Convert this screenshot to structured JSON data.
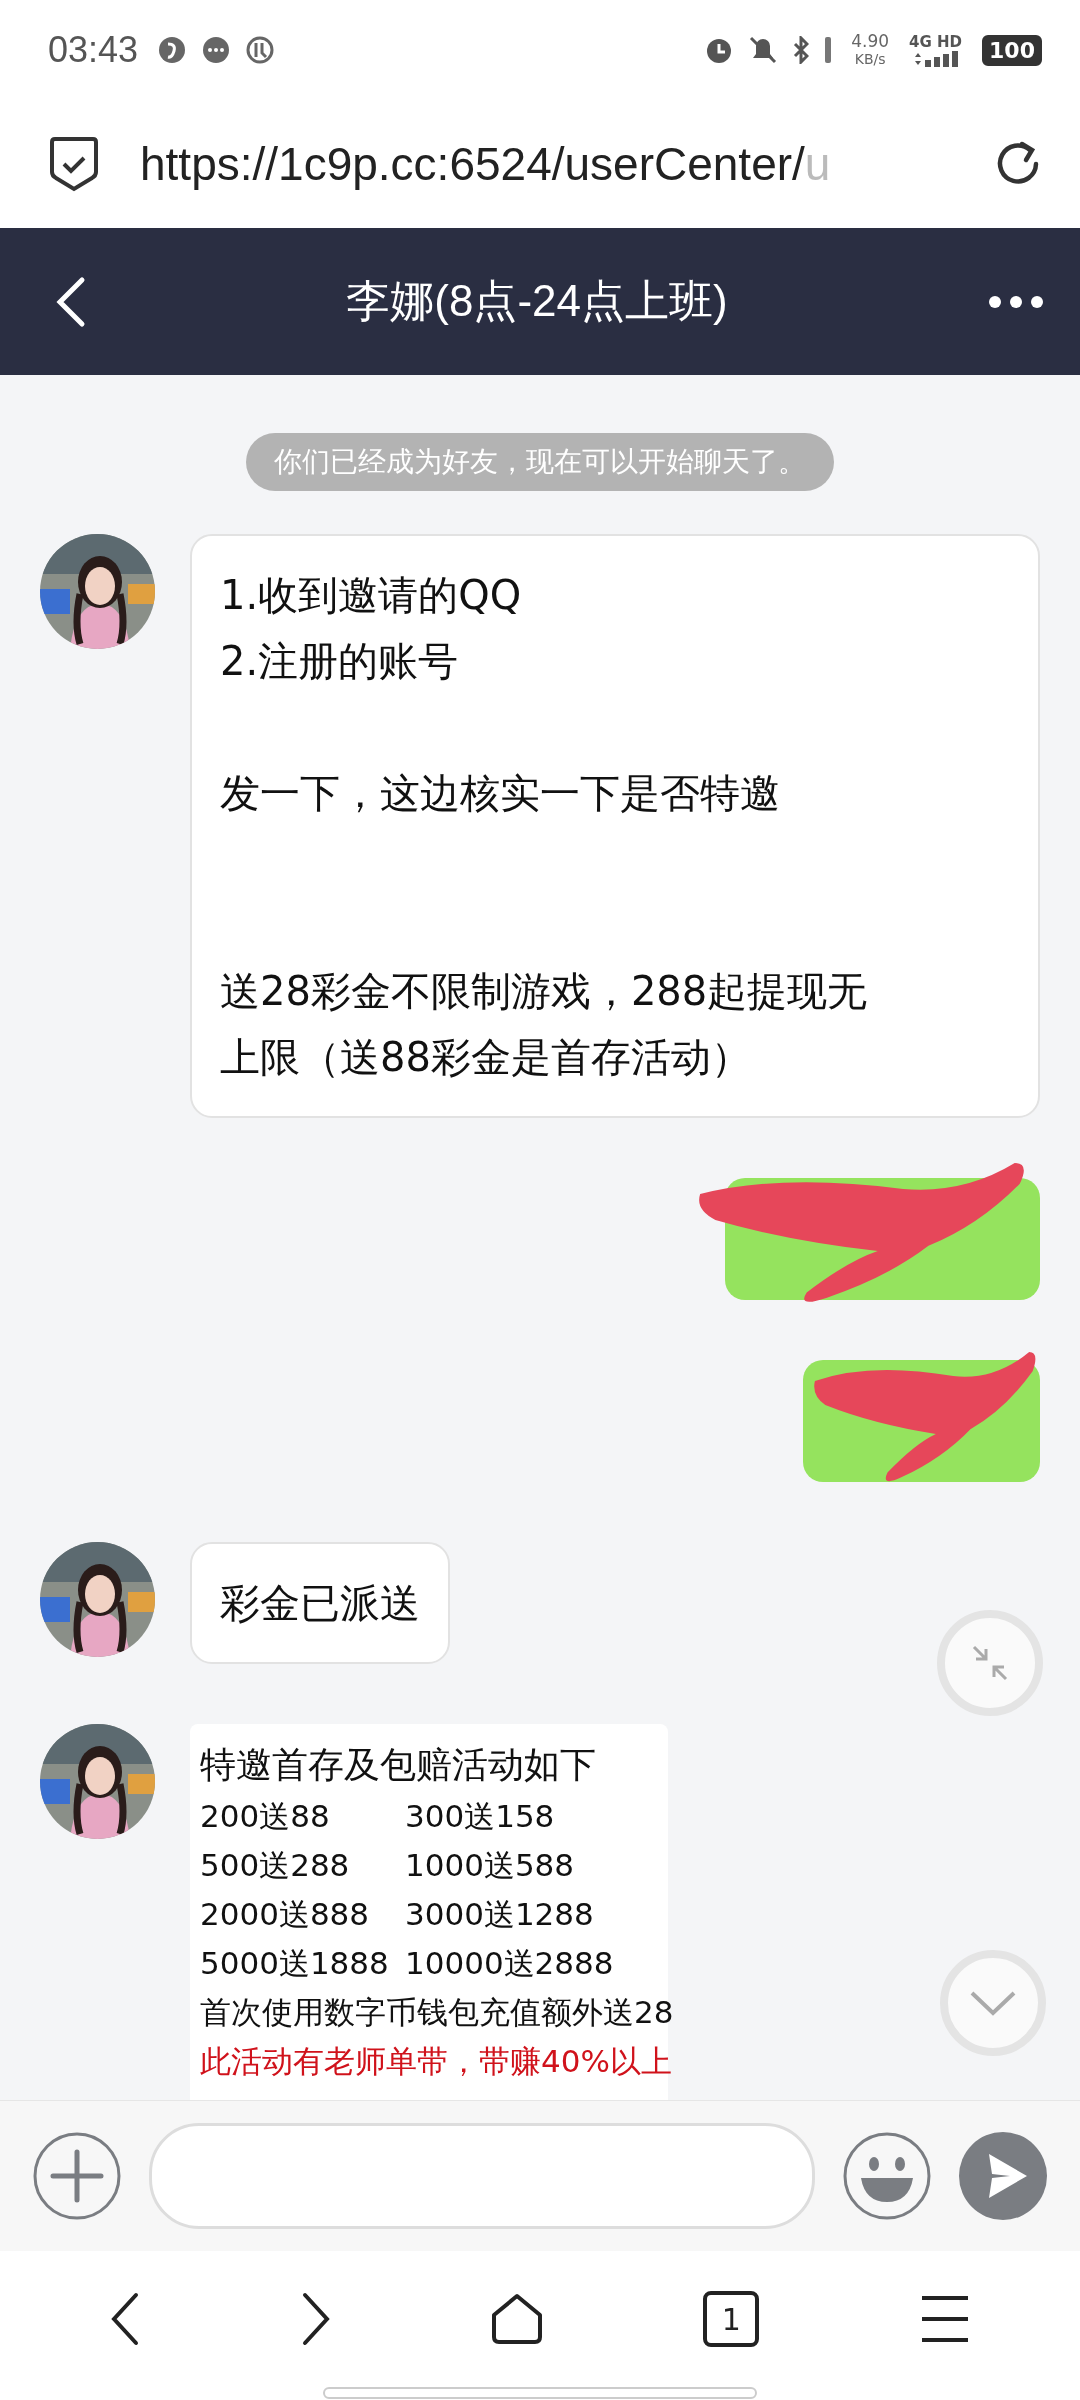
{
  "status_bar": {
    "time": "03:43",
    "speed": "4.90",
    "speed_unit": "KB/s",
    "network": "4G",
    "hd": "HD",
    "battery": "100"
  },
  "browser": {
    "url": "https://1c9p.cc:6524/userCenter/",
    "url_faded": "u"
  },
  "header": {
    "title": "李娜(8点-24点上班)"
  },
  "notice": "你们已经成为好友，现在可以开始聊天了。",
  "messages": [
    {
      "outgoing": false,
      "kind": "text",
      "paragraphs": [
        [
          "1.收到邀请的QQ",
          "2.注册的账号"
        ],
        [
          "发一下，这边核实一下是否特邀"
        ],
        [
          "送28彩金不限制游戏，288起提现无上限（送88彩金是首存活动）"
        ]
      ]
    },
    {
      "outgoing": true,
      "kind": "redacted"
    },
    {
      "outgoing": true,
      "kind": "redacted"
    },
    {
      "outgoing": false,
      "kind": "text",
      "paragraphs": [
        [
          "彩金已派送"
        ]
      ]
    },
    {
      "outgoing": false,
      "kind": "promo",
      "title": "特邀首存及包赔活动如下",
      "rows": [
        [
          "200送88",
          "300送158"
        ],
        [
          "500送288",
          "1000送588"
        ],
        [
          "2000送888",
          "3000送1288"
        ],
        [
          "5000送1888",
          "10000送2888"
        ]
      ],
      "note": "首次使用数字币钱包充值额外送28",
      "highlight": "此活动有老师单带，带赚40%以上"
    }
  ],
  "nav": {
    "tab_count": "1"
  }
}
